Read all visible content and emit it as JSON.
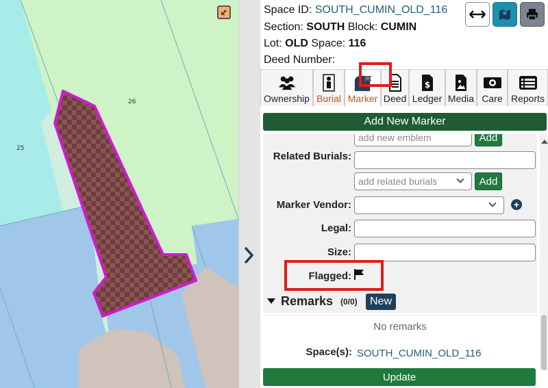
{
  "map": {
    "labels": [
      "26",
      "25"
    ],
    "zoom_icon": "collapse-arrows-icon"
  },
  "panel": {
    "space_id_label": "Space ID:",
    "space_id_value": "SOUTH_CUMIN_OLD_116",
    "section_label": "Section:",
    "section_value": "SOUTH",
    "block_label": "Block:",
    "block_value": "CUMIN",
    "lot_label": "Lot:",
    "lot_value": "OLD",
    "space_label": "Space:",
    "space_value": "116",
    "deed_number_label": "Deed Number:",
    "top_buttons": [
      "resize-horizontal-icon",
      "map-icon",
      "print-icon"
    ]
  },
  "tabs": [
    {
      "label": "Ownership",
      "icon": "people-icon"
    },
    {
      "label": "Burial",
      "icon": "person-icon"
    },
    {
      "label": "Marker",
      "icon": "marker-flag-icon"
    },
    {
      "label": "Deed",
      "icon": "document-icon"
    },
    {
      "label": "Ledger",
      "icon": "invoice-dollar-icon"
    },
    {
      "label": "Media",
      "icon": "image-icon"
    },
    {
      "label": "Care",
      "icon": "money-icon"
    },
    {
      "label": "Reports",
      "icon": "list-icon"
    }
  ],
  "active_tab": "Marker",
  "add_marker_label": "Add New Marker",
  "form": {
    "emblem_placeholder": "add new emblem",
    "emblem_add": "Add",
    "related_burials_label": "Related Burials:",
    "related_burials_select_placeholder": "add related burials",
    "related_add": "Add",
    "marker_vendor_label": "Marker Vendor:",
    "legal_label": "Legal:",
    "size_label": "Size:",
    "flagged_label": "Flagged:"
  },
  "remarks": {
    "title": "Remarks",
    "count": "(0/0)",
    "new_label": "New",
    "empty_text": "No remarks"
  },
  "spaces": {
    "label": "Space(s):",
    "value": "SOUTH_CUMIN_OLD_116"
  },
  "update_label": "Update",
  "colors": {
    "green_primary": "#1f7a3d",
    "green_dark": "#1f5b33",
    "highlight_red": "#e21b1b",
    "plot_outline": "#d11ad1"
  }
}
